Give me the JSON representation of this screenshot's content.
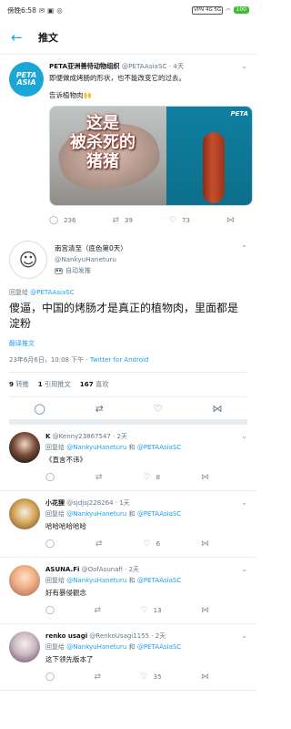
{
  "status_bar": {
    "carrier": "傍晚6:58",
    "icons_left": [
      "message-icon",
      "image-icon",
      "alarm-icon"
    ],
    "signal_text": "VPN 4G 5G",
    "battery": "100"
  },
  "app_bar": {
    "back_icon": "back-arrow-icon",
    "title": "推文"
  },
  "main_tweet": {
    "name": "PETA亚洲善待动物组织",
    "handle": "@PETAAsiaSC",
    "time": "· 4天",
    "text": "即便做成烤肠的形状，也不能改变它的过去。",
    "caption": "告诉植物肉🙌",
    "media_overlay": "这是\n被杀死的\n猪猪",
    "media_mark": "PETA",
    "avatar_text": "PETA ASIA",
    "replies": "236",
    "retweets": "39",
    "likes": "73"
  },
  "focus_tweet": {
    "name": "南宫清至（底色第0天）",
    "handle": "@NankyuHaneturu",
    "auto_label": "自动发推",
    "replying_prefix": "回复给 ",
    "replying_to": "@PETAAsiaSC",
    "text": "傻逼，中国的烤肠才是真正的植物肉，里面都是淀粉",
    "translate": "翻译推文",
    "timestamp": "23年6月6日，10:08 下午 · ",
    "source": "Twitter for Android",
    "stats": {
      "retweets_count": "9",
      "retweets_label": "转推",
      "quotes_count": "1",
      "quotes_label": "引用推文",
      "likes_count": "167",
      "likes_label": "喜欢"
    }
  },
  "replies": [
    {
      "name": "K",
      "handle": "@Kenny23867547",
      "time": "· 2天",
      "replying_prefix": "回复给 ",
      "replying_to_1": "@NankyuHaneturu",
      "replying_and": " 和 ",
      "replying_to_2": "@PETAAsiaSC",
      "text": "《直言不讳》",
      "likes": "8"
    },
    {
      "name": "小花狸",
      "handle": "@sjdjsj228264",
      "time": "· 1天",
      "replying_prefix": "回复给 ",
      "replying_to_1": "@NankyuHaneturu",
      "replying_and": " 和 ",
      "replying_to_2": "@PETAAsiaSC",
      "text": "哈哈哈哈哈哈",
      "likes": "6"
    },
    {
      "name": "ASUNA.Fi",
      "handle": "@OofAsunafi",
      "time": "· 2天",
      "replying_prefix": "回复给 ",
      "replying_to_1": "@NankyuHaneturu",
      "replying_and": " 和 ",
      "replying_to_2": "@PETAAsiaSC",
      "text": "好有暴侵觀念",
      "likes": "13"
    },
    {
      "name": "renko usagi",
      "handle": "@RenkoUsagi1155",
      "time": "· 2天",
      "replying_prefix": "回复给 ",
      "replying_to_1": "@NankyuHaneturu",
      "replying_and": " 和 ",
      "replying_to_2": "@PETAAsiaSC",
      "text": "这下领先版本了",
      "likes": "35"
    }
  ]
}
